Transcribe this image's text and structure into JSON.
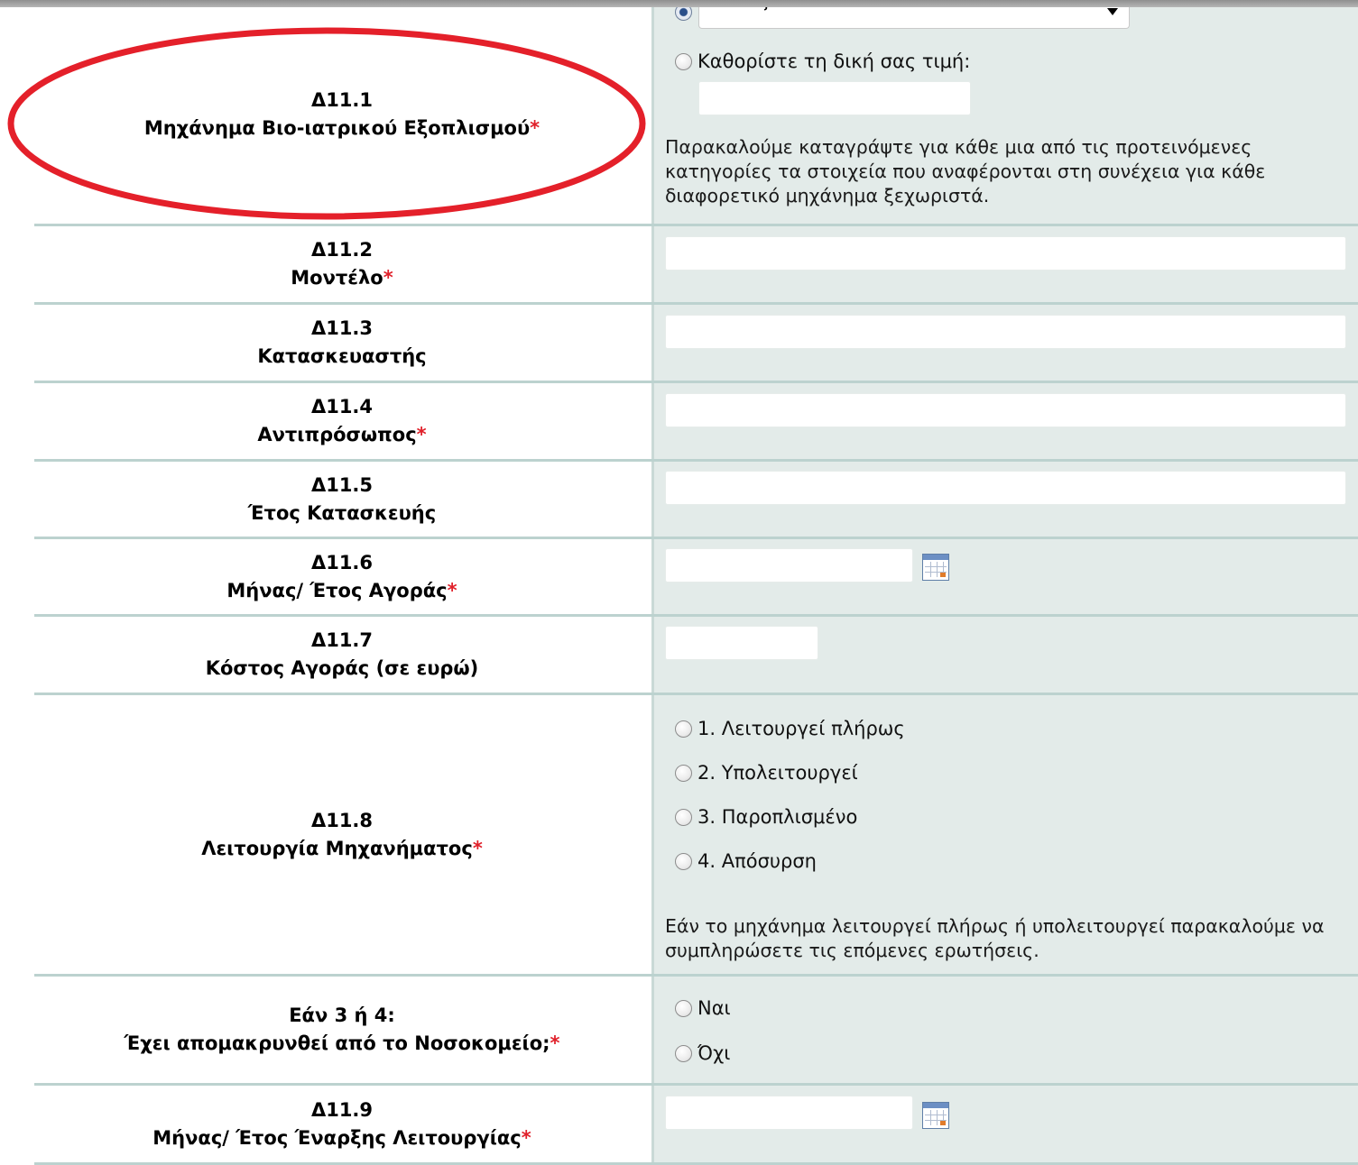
{
  "colors": {
    "required_marker": "#e0202a",
    "value_cell_bg": "#e3ebe9",
    "row_divider": "#bcd2cf",
    "annotation_ellipse": "#e4202a"
  },
  "rows": {
    "d11_1": {
      "code": "Δ11.1",
      "label": "Μηχάνημα Βιο-ιατρικού Εξοπλισμού",
      "required": "*",
      "select_option": "Επιλέξτε:",
      "custom_option": "Καθορίστε τη δική σας τιμή:",
      "select_checked": true,
      "custom_value": "",
      "note": "Παρακαλούμε καταγράψτε για κάθε μια από τις προτεινόμενες κατηγορίες τα στοιχεία που αναφέρονται στη συνέχεια για κάθε διαφορετικό μηχάνημα ξεχωριστά."
    },
    "d11_2": {
      "code": "Δ11.2",
      "label": "Μοντέλο",
      "required": "*",
      "value": ""
    },
    "d11_3": {
      "code": "Δ11.3",
      "label": "Κατασκευαστής",
      "value": ""
    },
    "d11_4": {
      "code": "Δ11.4",
      "label": "Αντιπρόσωπος",
      "required": "*",
      "value": ""
    },
    "d11_5": {
      "code": "Δ11.5",
      "label": "Έτος Κατασκευής",
      "value": ""
    },
    "d11_6": {
      "code": "Δ11.6",
      "label": "Μήνας/ Έτος Αγοράς",
      "required": "*",
      "value": "",
      "icon": "calendar-icon"
    },
    "d11_7": {
      "code": "Δ11.7",
      "label": "Κόστος Αγοράς (σε ευρώ)",
      "value": ""
    },
    "d11_8": {
      "code": "Δ11.8",
      "label": "Λειτουργία Μηχανήματος",
      "required": "*",
      "options": [
        "1. Λειτουργεί πλήρως",
        "2. Υπολειτουργεί",
        "3. Παροπλισμένο",
        "4. Απόσυρση"
      ],
      "note": "Εάν το μηχάνημα λειτουργεί πλήρως ή υπολειτουργεί παρακαλούμε να συμπληρώσετε τις επόμενες ερωτήσεις."
    },
    "removed": {
      "code": "Εάν 3 ή 4:",
      "label": "Έχει απομακρυνθεί από το Νοσοκομείο;",
      "required": "*",
      "options": [
        "Ναι",
        "Όχι"
      ]
    },
    "d11_9": {
      "code": "Δ11.9",
      "label": "Μήνας/ Έτος Έναρξης Λειτουργίας",
      "required": "*",
      "value": "",
      "icon": "calendar-icon"
    }
  }
}
